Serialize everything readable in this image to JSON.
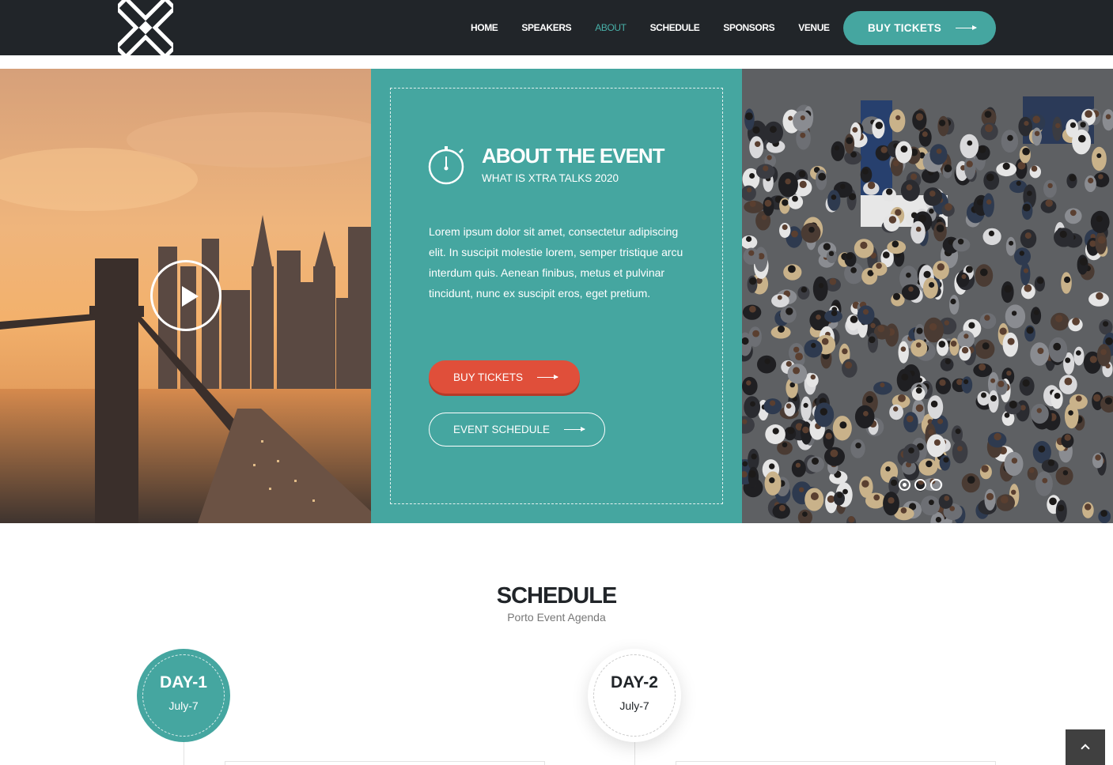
{
  "header": {
    "logo_icon": "x-logo-icon",
    "nav": [
      {
        "label": "HOME",
        "active": false
      },
      {
        "label": "SPEAKERS",
        "active": false
      },
      {
        "label": "ABOUT",
        "active": true
      },
      {
        "label": "SCHEDULE",
        "active": false
      },
      {
        "label": "SPONSORS",
        "active": false
      },
      {
        "label": "VENUE",
        "active": false
      }
    ],
    "cta_label": "BUY TICKETS"
  },
  "hero": {
    "video_icon": "play-icon",
    "about_icon": "stopwatch-icon",
    "title": "ABOUT THE EVENT",
    "subtitle": "WHAT IS XTRA TALKS 2020",
    "text": "Lorem ipsum dolor sit amet, consectetur adipiscing elit. In suscipit molestie lorem, semper tristique arcu interdum quis. Aenean finibus, metus et pulvinar tincidunt, nunc ex suscipit eros, eget pretium.",
    "buy_label": "BUY TICKETS",
    "schedule_label": "EVENT SCHEDULE",
    "slider_active_index": 0,
    "slider_count": 3
  },
  "schedule": {
    "title": "SCHEDULE",
    "subtitle": "Porto Event Agenda",
    "days": [
      {
        "name": "DAY-1",
        "date": "July-7"
      },
      {
        "name": "DAY-2",
        "date": "July-7"
      }
    ]
  },
  "colors": {
    "teal": "#45a6a0",
    "red": "#e04f3a",
    "dark": "#212529"
  }
}
